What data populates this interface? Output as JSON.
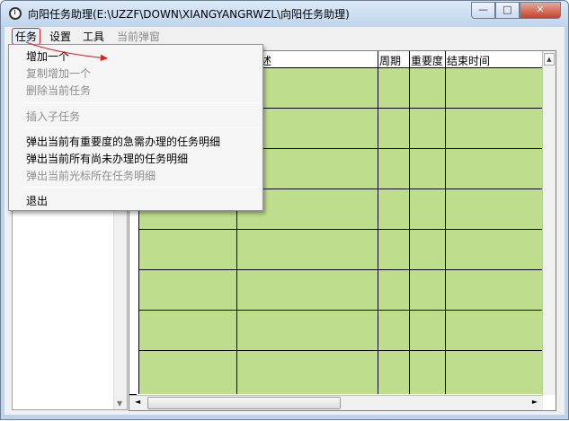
{
  "window": {
    "title": "向阳任务助理(E:\\UZZF\\DOWN\\XIANGYANGRWZL\\向阳任务助理)",
    "controls": {
      "minimize": "—",
      "maximize": "□",
      "close": "✕"
    }
  },
  "menubar": {
    "items": [
      {
        "label": "任务",
        "state": "active"
      },
      {
        "label": "设置",
        "state": "normal"
      },
      {
        "label": "工具",
        "state": "normal"
      },
      {
        "label": "当前弹窗",
        "state": "disabled"
      }
    ]
  },
  "task_menu": {
    "items": [
      {
        "label": "增加一个",
        "enabled": true
      },
      {
        "label": "复制增加一个",
        "enabled": false
      },
      {
        "label": "删除当前任务",
        "enabled": false
      },
      {
        "label": "插入子任务",
        "enabled": false
      },
      {
        "label": "弹出当前有重要度的急需办理的任务明细",
        "enabled": true
      },
      {
        "label": "弹出当前所有尚未办理的任务明细",
        "enabled": true
      },
      {
        "label": "弹出当前光标所在任务明细",
        "enabled": false
      },
      {
        "label": "退出",
        "enabled": true
      }
    ]
  },
  "grid": {
    "columns": [
      "述",
      "周期",
      "重要度",
      "结束时间"
    ],
    "row_count": 8,
    "fill_color": "#bedd8d"
  },
  "scroll": {
    "left": "◄",
    "right": "►",
    "up": "▲",
    "down": "▼"
  },
  "colors": {
    "highlight_red": "#dd2222"
  }
}
